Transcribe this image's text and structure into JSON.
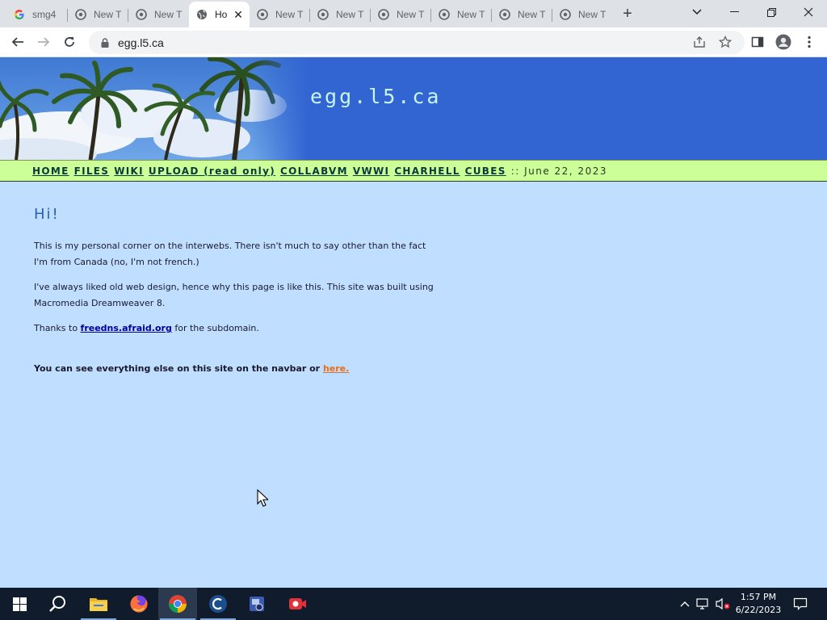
{
  "browser": {
    "tabs": [
      {
        "title": "smg4",
        "icon": "google-icon",
        "active": false
      },
      {
        "title": "New Tab",
        "icon": "chrome-icon",
        "active": false
      },
      {
        "title": "New Tab",
        "icon": "chrome-icon",
        "active": false
      },
      {
        "title": "Home",
        "icon": "globe-icon",
        "active": true
      },
      {
        "title": "New Tab",
        "icon": "chrome-icon",
        "active": false
      },
      {
        "title": "New Tab",
        "icon": "chrome-icon",
        "active": false
      },
      {
        "title": "New Tab",
        "icon": "chrome-icon",
        "active": false
      },
      {
        "title": "New Tab",
        "icon": "chrome-icon",
        "active": false
      },
      {
        "title": "New Tab",
        "icon": "chrome-icon",
        "active": false
      },
      {
        "title": "New Tab",
        "icon": "chrome-icon",
        "active": false
      }
    ],
    "tab_titles_visible": [
      "smg4",
      "New T",
      "New T",
      "Ho",
      "New T",
      "New T",
      "New T",
      "New T",
      "New T",
      "New T"
    ],
    "url": "egg.l5.ca"
  },
  "site": {
    "title": "egg.l5.ca",
    "nav": {
      "home": "HOME",
      "files": "FILES",
      "wiki": "WIKI",
      "upload": "UPLOAD (read only)",
      "collabvm": "COLLABVM",
      "vwwi": "VWWI",
      "charhell": "CHARHELL",
      "cubes": "CUBES",
      "date": ":: June 22, 2023"
    },
    "heading": "Hi!",
    "para1": "This is my personal corner on the interwebs. There isn't much to say other than the fact I'm from Canada (no, I'm not french.)",
    "para2": "I've always liked old web design, hence why this page is like this. This site was built using Macromedia Dreamweaver 8.",
    "para3_before": "Thanks to ",
    "para3_link": "freedns.afraid.org",
    "para3_after": " for the subdomain.",
    "para4_text": "You can see everything else on this site on the navbar or ",
    "para4_link": "here."
  },
  "taskbar": {
    "time": "1:57 PM",
    "date": "6/22/2023",
    "apps": [
      "start-button",
      "search-icon",
      "file-explorer-icon",
      "firefox-icon",
      "chrome-icon",
      "ccleaner-icon",
      "remote-desktop-icon",
      "screen-recorder-icon"
    ]
  },
  "colors": {
    "page_bg": "#c0deff",
    "banner_bg": "#3265d2",
    "navbar_bg": "#cdff99",
    "heading": "#2b5fb0",
    "link": "#000099",
    "here_link": "#e56f1a"
  }
}
